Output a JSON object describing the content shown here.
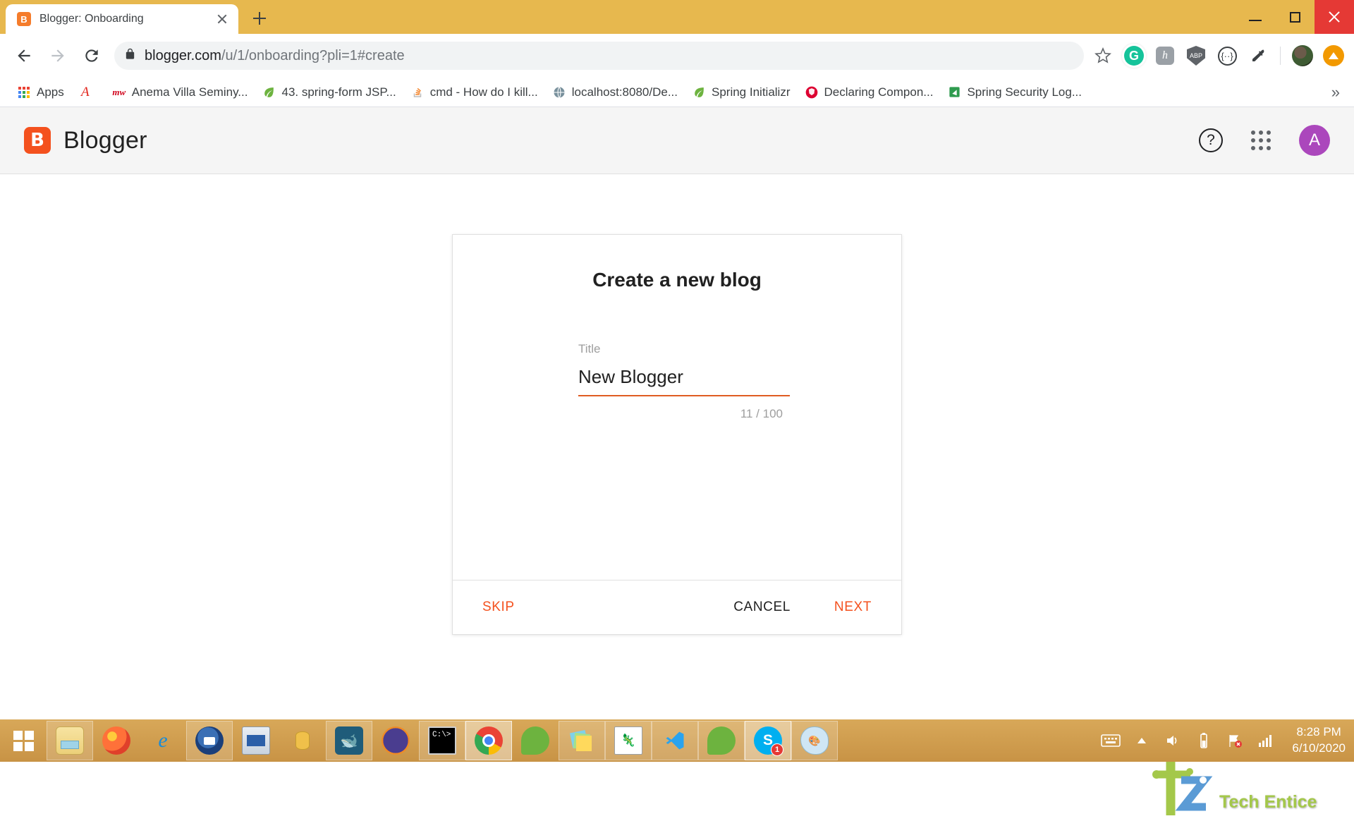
{
  "browser": {
    "tab": {
      "title": "Blogger: Onboarding",
      "favicon": "blogger-favicon",
      "close_icon": "close-icon"
    },
    "new_tab_label": "+",
    "window_controls": {
      "minimize": "minimize-icon",
      "maximize": "maximize-icon",
      "close": "close-icon"
    },
    "nav": {
      "back": "back-arrow-icon",
      "forward": "forward-arrow-icon",
      "reload": "reload-icon"
    },
    "omnibox": {
      "lock_icon": "lock-icon",
      "url_bold": "blogger.com",
      "url_rest": "/u/1/onboarding?pli=1#create",
      "full_url": "blogger.com/u/1/onboarding?pli=1#create",
      "bookmark_icon": "star-icon"
    },
    "extensions": [
      {
        "name": "grammarly-extension-icon",
        "glyph": "G",
        "color": "#15c39a"
      },
      {
        "name": "honey-extension-icon",
        "glyph": "h",
        "color": "#9aa0a6"
      },
      {
        "name": "adblock-shield-extension-icon",
        "glyph": "ABP",
        "color": "#5f6368"
      },
      {
        "name": "code-braces-extension-icon",
        "glyph": "{···}",
        "color": "#3c4043"
      },
      {
        "name": "eyedropper-extension-icon",
        "glyph": "✒",
        "color": "#3c4043"
      }
    ],
    "profile": {
      "name": "profile-avatar"
    },
    "update_button": {
      "name": "update-chrome-button"
    },
    "bookmarks": [
      {
        "label": "Apps",
        "icon": "apps-grid-icon"
      },
      {
        "label": "",
        "icon": "adobe-acrobat-icon"
      },
      {
        "label": "Anema Villa Seminy...",
        "icon": "mw-icon"
      },
      {
        "label": "43. spring-form JSP...",
        "icon": "leaf-icon"
      },
      {
        "label": "cmd - How do I kill...",
        "icon": "stackoverflow-icon"
      },
      {
        "label": "localhost:8080/De...",
        "icon": "globe-icon"
      },
      {
        "label": "Spring Initializr",
        "icon": "leaf-icon"
      },
      {
        "label": "Declaring Compon...",
        "icon": "angular-icon"
      },
      {
        "label": "Spring Security Log...",
        "icon": "green-doc-icon"
      }
    ],
    "bookmarks_overflow": "»"
  },
  "blogger": {
    "brand": {
      "mark_letter": "B",
      "word": "Blogger"
    },
    "header_actions": {
      "help": "help-circle-icon",
      "apps": "google-apps-grid-icon",
      "avatar_letter": "A",
      "avatar_color": "#ab47bc"
    }
  },
  "dialog": {
    "title": "Create a new blog",
    "field": {
      "label": "Title",
      "value": "New Blogger",
      "placeholder": "",
      "counter": "11 / 100",
      "underline_color": "#e05c22"
    },
    "buttons": {
      "skip": "SKIP",
      "cancel": "CANCEL",
      "next": "NEXT",
      "accent_color": "#f4511e"
    }
  },
  "watermark": {
    "text": "Tech Entice"
  },
  "taskbar": {
    "start": "windows-start-icon",
    "items": [
      {
        "name": "file-explorer-icon",
        "pinned": true
      },
      {
        "name": "firefox-icon",
        "pinned": false
      },
      {
        "name": "internet-explorer-icon",
        "pinned": false
      },
      {
        "name": "thunderbird-icon",
        "pinned": true
      },
      {
        "name": "remote-desktop-icon",
        "pinned": false
      },
      {
        "name": "database-tool-icon",
        "pinned": false
      },
      {
        "name": "mysql-workbench-icon",
        "pinned": true
      },
      {
        "name": "eclipse-icon",
        "pinned": true
      },
      {
        "name": "command-prompt-icon",
        "pinned": true
      },
      {
        "name": "google-chrome-icon",
        "pinned": true,
        "active": true
      },
      {
        "name": "spring-tool-suite-icon",
        "pinned": false
      },
      {
        "name": "sticky-notes-icon",
        "pinned": true
      },
      {
        "name": "notepad-plus-plus-icon",
        "pinned": true
      },
      {
        "name": "visual-studio-code-icon",
        "pinned": true
      },
      {
        "name": "spring-leaf-icon",
        "pinned": true
      },
      {
        "name": "skype-icon",
        "pinned": true,
        "badge": "1"
      },
      {
        "name": "paint-icon",
        "pinned": true
      }
    ],
    "tray": {
      "keyboard": "touch-keyboard-icon",
      "show_hidden": "show-hidden-icons-icon",
      "volume": "volume-icon",
      "battery": "battery-icon",
      "network": "network-error-icon",
      "signal": "signal-bars-icon"
    },
    "clock": {
      "time": "8:28 PM",
      "date": "6/10/2020"
    }
  }
}
